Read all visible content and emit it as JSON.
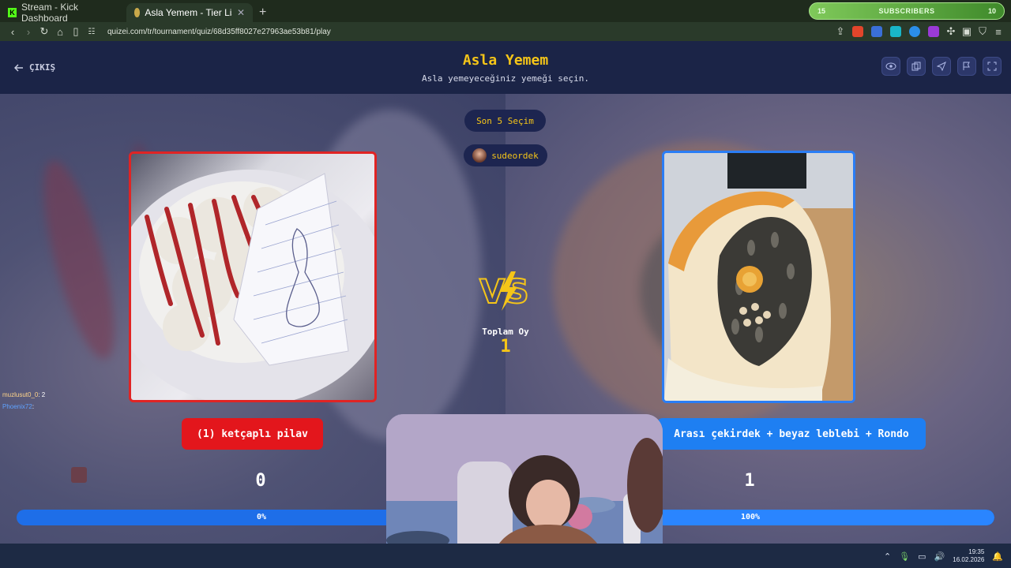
{
  "browser": {
    "tabs": [
      {
        "label": "Stream - Kick Dashboard",
        "active": false
      },
      {
        "label": "Asla Yemem - Tier List, Kör Sırala",
        "active": true
      }
    ],
    "url": "quizei.com/tr/tournament/quiz/68d35ff8027e27963ae53b81/play",
    "subscribers": {
      "left": "15",
      "label": "SUBSCRIBERS",
      "right": "10"
    }
  },
  "header": {
    "exit_label": "ÇIKIŞ",
    "title": "Asla Yemem",
    "subtitle": "Asla yemeyeceğiniz yemeği seçin.",
    "icons": [
      "eye-icon",
      "copy-icon",
      "send-icon",
      "flag-icon",
      "fullscreen-icon"
    ]
  },
  "main": {
    "last5_label": "Son 5 Seçim",
    "user": "sudeordek",
    "total_label": "Toplam Oy",
    "total_value": "1",
    "left": {
      "label": "(1) ketçaplı pilav",
      "votes": "0",
      "percent_label": "0%",
      "percent": 0,
      "color": "#e3161c"
    },
    "right": {
      "label": "Arası çekirdek + beyaz leblebi + Rondo",
      "votes": "1",
      "percent_label": "100%",
      "percent": 100,
      "color": "#1e7ff2"
    }
  },
  "overlay": {
    "chat": [
      {
        "user": "muzlusut0_0",
        "text": ": 2"
      },
      {
        "user": "Phoenix72",
        "text": ":"
      }
    ]
  },
  "taskbar": {
    "time": "19:35",
    "date": "16.02.2026"
  },
  "colors": {
    "accent": "#f5c518",
    "background": "#1b2447",
    "left": "#e3161c",
    "right": "#1e7ff2"
  }
}
